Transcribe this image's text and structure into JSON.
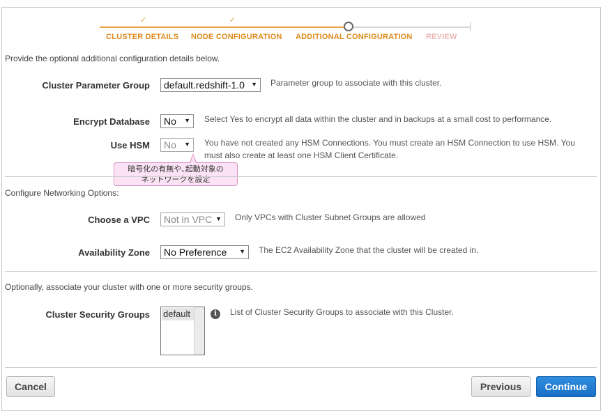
{
  "wizard": {
    "steps": [
      {
        "label": "CLUSTER DETAILS",
        "state": "done",
        "check": "✓"
      },
      {
        "label": "NODE CONFIGURATION",
        "state": "done",
        "check": "✓"
      },
      {
        "label": "ADDITIONAL CONFIGURATION",
        "state": "current"
      },
      {
        "label": "REVIEW",
        "state": "future"
      }
    ],
    "colors": {
      "done": "#de8a1b",
      "future": "#e8b7b7"
    }
  },
  "intro_text": "Provide the optional additional configuration details below.",
  "parameter_group": {
    "label": "Cluster Parameter Group",
    "value": "default.redshift-1.0",
    "help": "Parameter group to associate with this cluster."
  },
  "encrypt": {
    "label": "Encrypt Database",
    "value": "No",
    "help": "Select Yes to encrypt all data within the cluster and in backups at a small cost to performance."
  },
  "hsm": {
    "label": "Use HSM",
    "value": "No",
    "help_line1": "You have not created any HSM Connections. You must create an HSM Connection to use HSM. You",
    "help_line2": "must also create at least one HSM Client Certificate."
  },
  "tooltip": {
    "line1": "暗号化の有無や､起動対象の",
    "line2": "ネットワークを設定"
  },
  "networking": {
    "heading": "Configure Networking Options:",
    "vpc": {
      "label": "Choose a VPC",
      "value": "Not in VPC",
      "help": "Only VPCs with Cluster Subnet Groups are allowed"
    },
    "az": {
      "label": "Availability Zone",
      "value": "No Preference",
      "help": "The EC2 Availability Zone that the cluster will be created in."
    }
  },
  "security": {
    "heading": "Optionally, associate your cluster with one or more security groups.",
    "label": "Cluster Security Groups",
    "options": [
      "default"
    ],
    "help": "List of Cluster Security Groups to associate with this Cluster.",
    "info_glyph": "i"
  },
  "footer": {
    "cancel": "Cancel",
    "previous": "Previous",
    "continue": "Continue"
  },
  "colors": {
    "accent": "#1a6fc4"
  }
}
